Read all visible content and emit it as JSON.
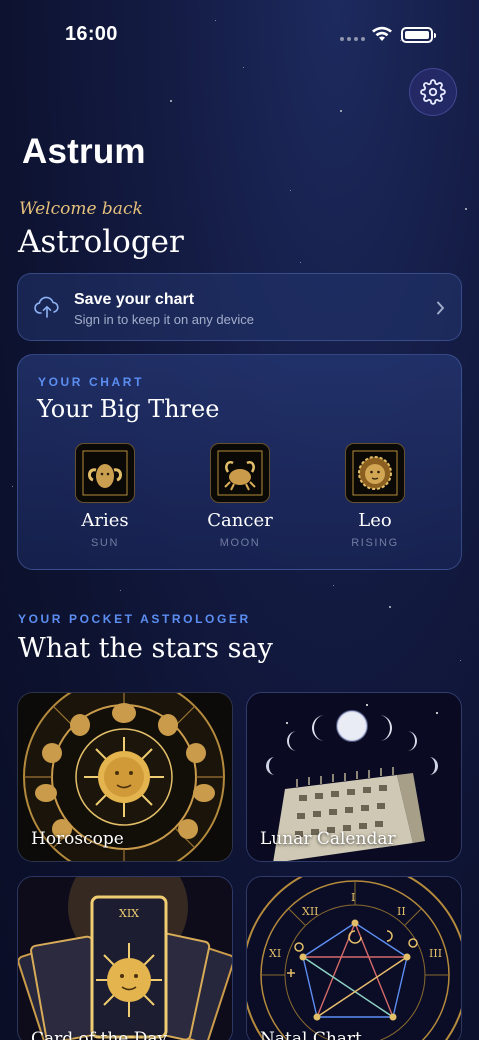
{
  "status_bar": {
    "time": "16:00"
  },
  "app": {
    "title": "Astrum"
  },
  "greeting": {
    "welcome": "Welcome back",
    "name": "Astrologer"
  },
  "save_card": {
    "title": "Save your chart",
    "subtitle": "Sign in to keep it on any device"
  },
  "big_three": {
    "eyebrow": "YOUR CHART",
    "title": "Your Big Three",
    "signs": [
      {
        "name": "Aries",
        "role": "SUN",
        "icon": "aries-ram-icon"
      },
      {
        "name": "Cancer",
        "role": "MOON",
        "icon": "cancer-crab-icon"
      },
      {
        "name": "Leo",
        "role": "RISING",
        "icon": "leo-lion-icon"
      }
    ]
  },
  "features": {
    "eyebrow": "YOUR POCKET ASTROLOGER",
    "title": "What the stars say",
    "tiles": [
      {
        "label": "Horoscope",
        "icon": "zodiac-wheel-icon"
      },
      {
        "label": "Lunar Calendar",
        "icon": "moon-calendar-icon"
      },
      {
        "label": "Card of the Day",
        "icon": "tarot-card-icon"
      },
      {
        "label": "Natal Chart",
        "icon": "natal-chart-icon"
      }
    ]
  },
  "colors": {
    "accent": "#5c8ef2",
    "gold": "#e4c07a",
    "background": "#0d1230"
  }
}
